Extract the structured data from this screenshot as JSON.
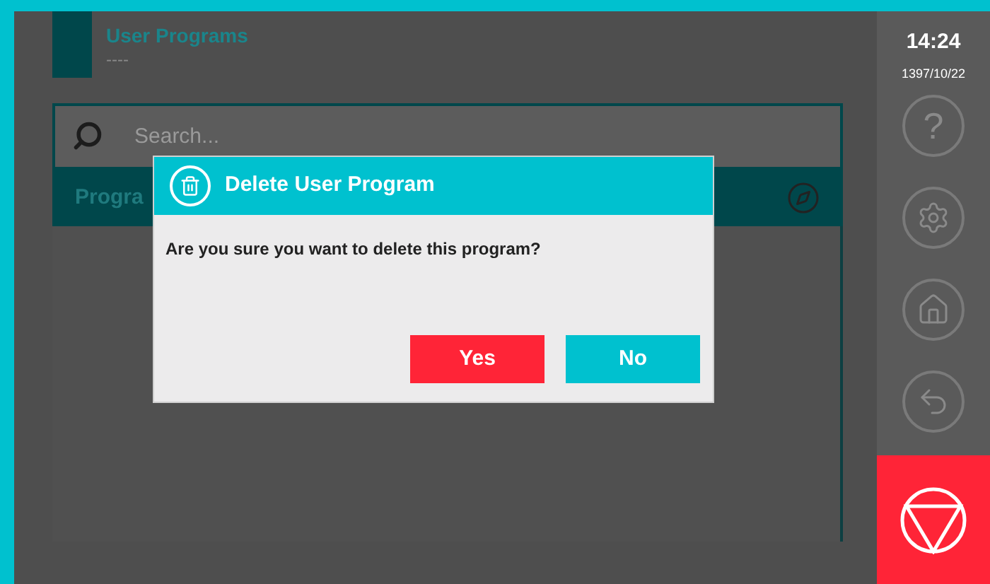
{
  "header": {
    "title": "User Programs",
    "subtitle": "----"
  },
  "search": {
    "placeholder": "Search..."
  },
  "list_header": {
    "label": "Progra"
  },
  "sidebar": {
    "time": "14:24",
    "date": "1397/10/22",
    "buttons": [
      {
        "kind": "help",
        "label": "?"
      },
      {
        "kind": "settings"
      },
      {
        "kind": "home"
      },
      {
        "kind": "back"
      }
    ]
  },
  "dialog": {
    "title": "Delete User Program",
    "message": "Are you sure you want to delete this program?",
    "buttons": [
      {
        "label": "Yes",
        "kind": "confirm"
      },
      {
        "label": "No",
        "kind": "cancel"
      }
    ]
  }
}
